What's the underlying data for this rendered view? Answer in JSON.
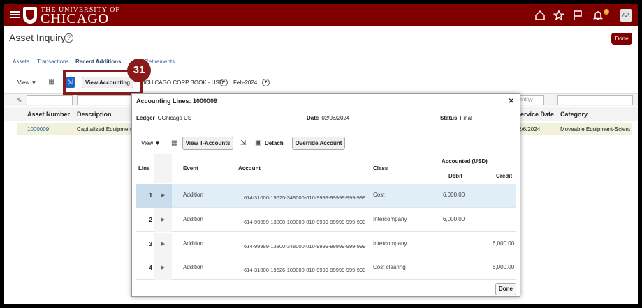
{
  "header": {
    "university_small": "THE UNIVERSITY OF",
    "university_big": "CHICAGO",
    "avatar_initials": "AA",
    "notification_count": "8"
  },
  "page": {
    "title": "Asset Inquiry",
    "done_label": "Done"
  },
  "tabs": [
    {
      "label": "Assets"
    },
    {
      "label": "Transactions"
    },
    {
      "label": "Recent Additions"
    },
    {
      "label": "Retirements"
    }
  ],
  "toolbar": {
    "view_label": "View",
    "view_accounting_label": "View Accounting",
    "book_label": "UCHICAGO CORP BOOK - USD",
    "period_label": "Feb-2024",
    "date_placeholder": "m/d/yy"
  },
  "callout": {
    "step_number": "31"
  },
  "bg_table": {
    "columns": [
      "Asset Number",
      "Description",
      "Service Date",
      "Category"
    ],
    "row": {
      "asset_number": "1000009",
      "description": "Capitalized Equipment",
      "service_date": "2/6/2024",
      "category": "Moveable Equipment-Scient"
    }
  },
  "modal": {
    "title": "Accounting Lines: 1000009",
    "ledger_label": "Ledger",
    "ledger_value": "UChicago US",
    "date_label": "Date",
    "date_value": "02/06/2024",
    "status_label": "Status",
    "status_value": "Final",
    "toolbar": {
      "view_label": "View",
      "t_accounts_label": "View T-Accounts",
      "detach_label": "Detach",
      "override_label": "Override Account"
    },
    "columns": {
      "line": "Line",
      "event": "Event",
      "account": "Account",
      "class": "Class",
      "accounted": "Accounted (USD)",
      "debit": "Debit",
      "credit": "Credit"
    },
    "rows": [
      {
        "line": "1",
        "event": "Addition",
        "account": "614-31000-19625-348000-010-9999-99999-999-999",
        "class": "Cost",
        "debit": "6,000.00",
        "credit": ""
      },
      {
        "line": "2",
        "event": "Addition",
        "account": "614-99999-13800-100000-010-9999-99999-999-999",
        "class": "Intercompany",
        "debit": "6,000.00",
        "credit": ""
      },
      {
        "line": "3",
        "event": "Addition",
        "account": "614-99999-13800-348000-010-9999-99999-999-999",
        "class": "Intercompany",
        "debit": "",
        "credit": "6,000.00"
      },
      {
        "line": "4",
        "event": "Addition",
        "account": "614-31000-19626-100000-010-9999-99999-999-999",
        "class": "Cost clearing",
        "debit": "",
        "credit": "6,000.00"
      }
    ],
    "done_label": "Done"
  }
}
